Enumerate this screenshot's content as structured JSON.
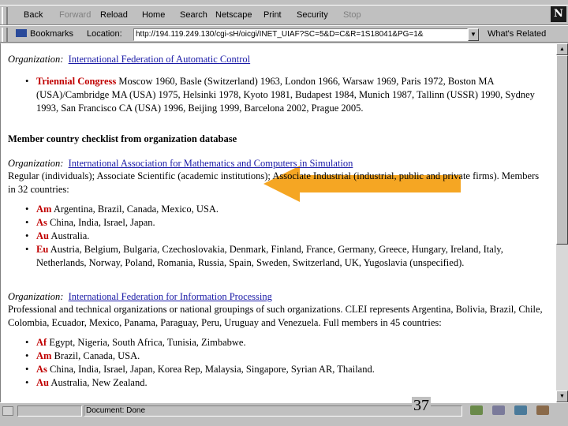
{
  "toolbar": {
    "back": "Back",
    "forward": "Forward",
    "reload": "Reload",
    "home": "Home",
    "search": "Search",
    "netscape": "Netscape",
    "print": "Print",
    "security": "Security",
    "stop": "Stop"
  },
  "location_bar": {
    "bookmarks": "Bookmarks",
    "location_label": "Location:",
    "url": "http://194.119.249.130/cgi-sH/oicgi/INET_UIAF?SC=5&D=C&R=1S18041&PG=1&",
    "whats_related": "What's Related"
  },
  "logo": "N",
  "content": {
    "org1": {
      "label": "Organization:",
      "name": "International Federation of Automatic Control",
      "items": [
        {
          "tag": "Triennial Congress",
          "text": "Moscow 1960, Basle (Switzerland) 1963, London 1966, Warsaw 1969, Paris 1972, Boston MA (USA)/Cambridge MA (USA) 1975, Helsinki 1978, Kyoto 1981, Budapest 1984, Munich 1987, Tallinn (USSR) 1990, Sydney 1993, San Francisco CA (USA) 1996, Beijing 1999, Barcelona 2002, Prague 2005."
        }
      ]
    },
    "heading": "Member country checklist from organization database",
    "org2": {
      "label": "Organization:",
      "name": "International Association for Mathematics and Computers in Simulation",
      "description": "Regular (individuals); Associate Scientific (academic institutions); Associate Industrial (industrial, public and private firms). Members in 32 countries:",
      "items": [
        {
          "tag": "Am",
          "text": "Argentina, Brazil, Canada, Mexico, USA."
        },
        {
          "tag": "As",
          "text": "China, India, Israel, Japan."
        },
        {
          "tag": "Au",
          "text": "Australia."
        },
        {
          "tag": "Eu",
          "text": "Austria, Belgium, Bulgaria, Czechoslovakia, Denmark, Finland, France, Germany, Greece, Hungary, Ireland, Italy, Netherlands, Norway, Poland, Romania, Russia, Spain, Sweden, Switzerland, UK, Yugoslavia (unspecified)."
        }
      ]
    },
    "org3": {
      "label": "Organization:",
      "name": "International Federation for Information Processing",
      "description": "Professional and technical organizations or national groupings of such organizations. CLEI represents Argentina, Bolivia, Brazil, Chile, Colombia, Ecuador, Mexico, Panama, Paraguay, Peru, Uruguay and Venezuela. Full members in 45 countries:",
      "items": [
        {
          "tag": "Af",
          "text": "Egypt, Nigeria, South Africa, Tunisia, Zimbabwe."
        },
        {
          "tag": "Am",
          "text": "Brazil, Canada, USA."
        },
        {
          "tag": "As",
          "text": "China, India, Israel, Japan, Korea Rep, Malaysia, Singapore, Syrian AR, Thailand."
        },
        {
          "tag": "Au",
          "text": "Australia, New Zealand."
        }
      ]
    }
  },
  "status": {
    "text": "Document: Done",
    "page_number": "37"
  },
  "colors": {
    "arrow": "#f5a623",
    "link": "#1a1aa6",
    "tag": "#c00000"
  }
}
